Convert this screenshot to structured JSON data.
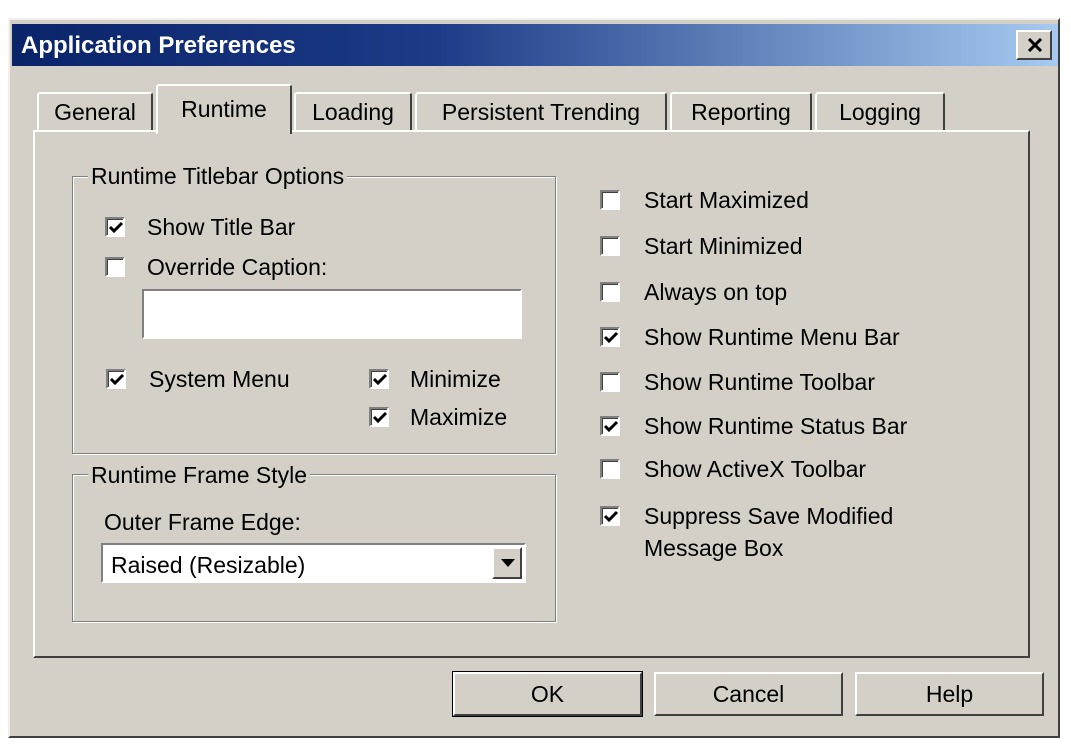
{
  "window": {
    "title": "Application Preferences"
  },
  "tabs": [
    {
      "label": "General",
      "active": false
    },
    {
      "label": "Runtime",
      "active": true
    },
    {
      "label": "Loading",
      "active": false
    },
    {
      "label": "Persistent Trending",
      "active": false
    },
    {
      "label": "Reporting",
      "active": false
    },
    {
      "label": "Logging",
      "active": false
    }
  ],
  "titlebar_options": {
    "legend": "Runtime Titlebar Options",
    "show_title_bar": {
      "label": "Show Title Bar",
      "checked": true
    },
    "override_caption": {
      "label": "Override Caption:",
      "checked": false,
      "value": ""
    },
    "system_menu": {
      "label": "System Menu",
      "checked": true
    },
    "minimize": {
      "label": "Minimize",
      "checked": true
    },
    "maximize": {
      "label": "Maximize",
      "checked": true
    }
  },
  "frame_style": {
    "legend": "Runtime Frame Style",
    "outer_frame_label": "Outer Frame Edge:",
    "outer_frame_value": "Raised (Resizable)"
  },
  "right_options": [
    {
      "label": "Start Maximized",
      "checked": false
    },
    {
      "label": "Start Minimized",
      "checked": false
    },
    {
      "label": "Always on top",
      "checked": false
    },
    {
      "label": "Show Runtime Menu Bar",
      "checked": true
    },
    {
      "label": "Show Runtime Toolbar",
      "checked": false
    },
    {
      "label": "Show Runtime Status Bar",
      "checked": true
    },
    {
      "label": "Show ActiveX Toolbar",
      "checked": false
    },
    {
      "label": "Suppress Save Modified",
      "label_line2": "Message Box",
      "checked": true
    }
  ],
  "buttons": {
    "ok": "OK",
    "cancel": "Cancel",
    "help": "Help"
  },
  "colors": {
    "face": "#d4d0c8",
    "title_start": "#0a246a",
    "title_end": "#a6caf0"
  }
}
